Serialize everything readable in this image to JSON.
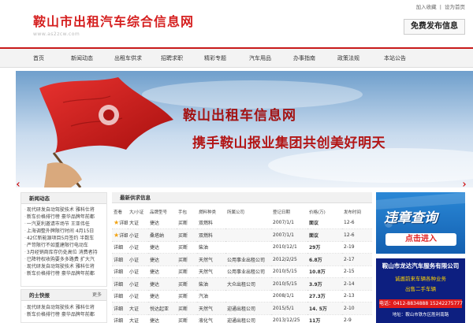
{
  "header": {
    "site_title": "鞍山市出租汽车综合信息网",
    "site_domain": "www.as2zcw.com",
    "toplinks": [
      "加入收藏",
      "设为首页"
    ],
    "toplink_sep": "|",
    "post_button": "免费发布信息"
  },
  "nav": [
    "首页",
    "新闻动态",
    "出租车供求",
    "招聘求职",
    "精彩专题",
    "汽车用品",
    "办事指南",
    "政策法规",
    "本站公告"
  ],
  "banner": {
    "title": "鞍山出租车信息网",
    "slogan": "携手鞍山报业集团共创美好明天"
  },
  "news": {
    "heading": "新闻动态",
    "items": [
      "现代研发自动驾驶技术 雅科仕将",
      "新车价格排行榜 豪华品牌年前都",
      "一汽夏利邀请市场节 王亚伟任",
      "上海调整外牌限行时间 4月15日",
      "42亿新能源项目5月签约 半数车",
      "严苛限行不如重建限行电动车",
      "3月经销商库存仍处高位 消费者持",
      "已降特权收购要多多路费 扩大汽",
      "现代研发自动驾驶技术 雅科仕将",
      "新车价格排行榜 豪华品牌年前都"
    ]
  },
  "hot": {
    "heading": "的士快报",
    "more": "更多",
    "items": [
      "现代研发自动驾驶技术 雅科仕将",
      "新车价格排行榜 豪华品牌年前都"
    ]
  },
  "listings": {
    "heading": "最新供求信息",
    "columns": [
      "查看",
      "大/小证",
      "品牌型号",
      "手包",
      "燃料种类",
      "所属公司",
      "登记日期",
      "价格(万)",
      "发布时间"
    ],
    "rows": [
      {
        "star": true,
        "view": "详细",
        "size": "大证",
        "brand": "捷达",
        "bag": "买断",
        "fuel": "双燃料",
        "company": "",
        "date": "2007/1/1",
        "price": "面议",
        "posted": "12-6"
      },
      {
        "star": true,
        "view": "详细",
        "size": "小证",
        "brand": "桑塔纳",
        "bag": "买断",
        "fuel": "双燃料",
        "company": "",
        "date": "2007/1/1",
        "price": "面议",
        "posted": "12-6"
      },
      {
        "star": false,
        "view": "详细",
        "size": "小证",
        "brand": "捷达",
        "bag": "买断",
        "fuel": "柴油",
        "company": "",
        "date": "2010/12/1",
        "price": "29万",
        "posted": "2-19"
      },
      {
        "star": false,
        "view": "详细",
        "size": "小证",
        "brand": "捷达",
        "bag": "买断",
        "fuel": "天然气",
        "company": "公用事业出租公司",
        "date": "2012/2/25",
        "price": "6.8万",
        "posted": "2-17"
      },
      {
        "star": false,
        "view": "详细",
        "size": "小证",
        "brand": "捷达",
        "bag": "买断",
        "fuel": "天然气",
        "company": "公用事业出租公司",
        "date": "2010/5/15",
        "price": "10.8万",
        "posted": "2-15"
      },
      {
        "star": false,
        "view": "详细",
        "size": "小证",
        "brand": "捷达",
        "bag": "买断",
        "fuel": "柴油",
        "company": "大众出租公司",
        "date": "2010/5/15",
        "price": "3.9万",
        "posted": "2-14"
      },
      {
        "star": false,
        "view": "详细",
        "size": "小证",
        "brand": "捷达",
        "bag": "买断",
        "fuel": "汽油",
        "company": "",
        "date": "2008/1/1",
        "price": "27.3万",
        "posted": "2-13"
      },
      {
        "star": false,
        "view": "详细",
        "size": "大证",
        "brand": "悦达起亚",
        "bag": "买断",
        "fuel": "天然气",
        "company": "迎通出租公司",
        "date": "2015/5/1",
        "price": "14. 5万",
        "posted": "2-10"
      },
      {
        "star": false,
        "view": "详细",
        "size": "大证",
        "brand": "捷达",
        "bag": "买断",
        "fuel": "液化气",
        "company": "迎通出租公司",
        "date": "2013/12/25",
        "price": "11万",
        "posted": "2-9"
      }
    ]
  },
  "ads": {
    "violation_title": "违章查询",
    "violation_button": "点击进入",
    "company": "鞍山市龙达汽车服务有限公司",
    "line1": "诚邀前来车辆各种业务",
    "line2": "出售二手车辆",
    "phone": "电话：0412-8834888  15242275777",
    "address": "地址：鞍山市铁东区胜利南路"
  },
  "colors": {
    "brand_red": "#d51f1f",
    "nav_border": "#c81b1b",
    "star": "#f2a20f",
    "ad_blue": "#2a88d6",
    "ad_navy": "#0d1f80"
  }
}
